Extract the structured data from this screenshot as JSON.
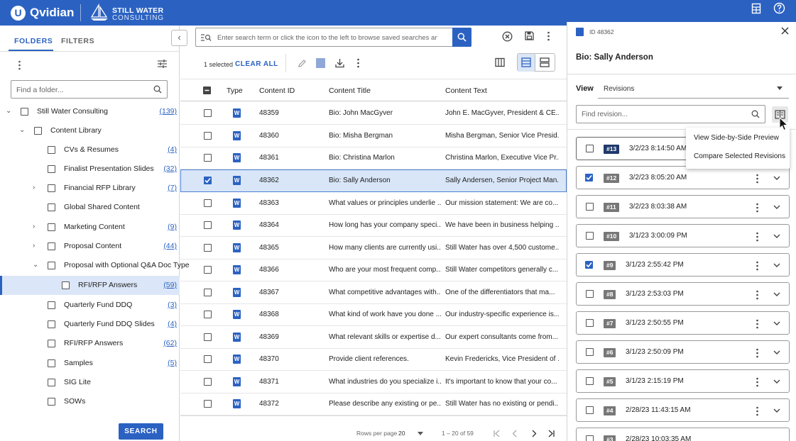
{
  "header": {
    "logo_letter": "U",
    "app_name": "Qvidian",
    "brand_line1": "STILL WATER",
    "brand_line2": "CONSULTING"
  },
  "left": {
    "tabs": [
      {
        "label": "FOLDERS"
      },
      {
        "label": "FILTERS"
      }
    ],
    "folder_search_placeholder": "Find a folder...",
    "tree": [
      {
        "label": "Still Water Consulting",
        "count": "(139)"
      },
      {
        "label": "Content Library",
        "count": ""
      },
      {
        "label": "CVs & Resumes",
        "count": "(4)"
      },
      {
        "label": "Finalist Presentation Slides",
        "count": "(32)"
      },
      {
        "label": "Financial RFP Library",
        "count": "(7)"
      },
      {
        "label": "Global Shared Content",
        "count": ""
      },
      {
        "label": "Marketing Content",
        "count": "(9)"
      },
      {
        "label": "Proposal Content",
        "count": "(44)"
      },
      {
        "label": "Proposal with Optional Q&A Doc Type",
        "count": ""
      },
      {
        "label": "RFI/RFP Answers",
        "count": "(59)"
      },
      {
        "label": "Quarterly Fund DDQ",
        "count": "(3)"
      },
      {
        "label": "Quarterly Fund DDQ Slides",
        "count": "(4)"
      },
      {
        "label": "RFI/RFP Answers",
        "count": "(62)"
      },
      {
        "label": "Samples",
        "count": "(5)"
      },
      {
        "label": "SIG Lite",
        "count": ""
      },
      {
        "label": "SOWs",
        "count": ""
      }
    ],
    "search_button": "SEARCH"
  },
  "middle": {
    "search_placeholder": "Enter search term or click the icon to the left to browse saved searches and hi",
    "selected_text": "1 selected",
    "clear_all": "CLEAR ALL",
    "columns": [
      "Type",
      "Content ID",
      "Content Title",
      "Content Text"
    ],
    "rows": [
      {
        "id": "48359",
        "title": "Bio: John MacGyver",
        "text": "John E. MacGyver, President & CE..."
      },
      {
        "id": "48360",
        "title": "Bio: Misha Bergman",
        "text": "Misha Bergman, Senior Vice Presid..."
      },
      {
        "id": "48361",
        "title": "Bio: Christina Marlon",
        "text": "Christina Marlon, Executive Vice Pr..."
      },
      {
        "id": "48362",
        "title": "Bio: Sally Anderson",
        "text": "Sally Andersen, Senior Project Man..."
      },
      {
        "id": "48363",
        "title": "What values or principles underlie ...",
        "text": "Our mission statement: We are co..."
      },
      {
        "id": "48364",
        "title": "How long has your company speci...",
        "text": "We have been in business helping ..."
      },
      {
        "id": "48365",
        "title": "How many clients are currently usi...",
        "text": "Still Water has over 4,500 custome..."
      },
      {
        "id": "48366",
        "title": "Who are your most frequent comp...",
        "text": "Still Water competitors generally c..."
      },
      {
        "id": "48367",
        "title": "What competitive advantages with...",
        "text": "One of the differentiators that ma..."
      },
      {
        "id": "48368",
        "title": "What kind of work have you done ...",
        "text": "Our industry-specific experience is..."
      },
      {
        "id": "48369",
        "title": "What relevant skills or expertise d...",
        "text": "Our expert consultants come from..."
      },
      {
        "id": "48370",
        "title": "Provide client references.",
        "text": "Kevin Fredericks, Vice President of ..."
      },
      {
        "id": "48371",
        "title": "What industries do you specialize i...",
        "text": "It's important to know that your co..."
      },
      {
        "id": "48372",
        "title": "Please describe any existing or pe...",
        "text": "Still Water has no existing or pendi..."
      }
    ],
    "word_letter": "W",
    "pager": {
      "rows_label": "Rows per page",
      "rows_value": "20",
      "range": "1 – 20 of 59"
    }
  },
  "right": {
    "id_label": "ID 48362",
    "title": "Bio: Sally Anderson",
    "view_label": "View",
    "view_value": "Revisions",
    "find_placeholder": "Find revision...",
    "popup": {
      "item1": "View Side-by-Side Preview",
      "item2": "Compare Selected Revisions"
    },
    "revisions": [
      {
        "badge": "#13",
        "date": "3/2/23 8:14:50 AM"
      },
      {
        "badge": "#12",
        "date": "3/2/23 8:05:20 AM"
      },
      {
        "badge": "#11",
        "date": "3/2/23 8:03:38 AM"
      },
      {
        "badge": "#10",
        "date": "3/1/23 3:00:09 PM"
      },
      {
        "badge": "#9",
        "date": "3/1/23 2:55:42 PM"
      },
      {
        "badge": "#8",
        "date": "3/1/23 2:53:03 PM"
      },
      {
        "badge": "#7",
        "date": "3/1/23 2:50:55 PM"
      },
      {
        "badge": "#6",
        "date": "3/1/23 2:50:09 PM"
      },
      {
        "badge": "#5",
        "date": "3/1/23 2:15:19 PM"
      },
      {
        "badge": "#4",
        "date": "2/28/23 11:43:15 AM"
      },
      {
        "badge": "#3",
        "date": "2/28/23 10:03:35 AM"
      }
    ]
  },
  "colors": {
    "brand_blue": "#2b62c2",
    "selected_row": "#d9e6f8",
    "badge_dark": "#1f3a6b",
    "badge_gray": "#777777"
  },
  "icons": [
    "grid-icon",
    "help-icon",
    "chevron-left-icon",
    "filter-sliders-icon",
    "search-icon",
    "saved-search-icon",
    "clear-icon",
    "save-icon",
    "kebab-icon",
    "edit-icon",
    "download-icon",
    "columns-icon",
    "list-view-icon",
    "card-view-icon",
    "word-doc-icon",
    "close-icon",
    "compare-icon",
    "chevron-down-icon",
    "cursor-icon"
  ],
  "state": {
    "selected_row_index": 3,
    "checked_revision_indices": [
      1,
      4
    ],
    "highlighted_revision_index": 0,
    "selected_tree_index": 9
  }
}
